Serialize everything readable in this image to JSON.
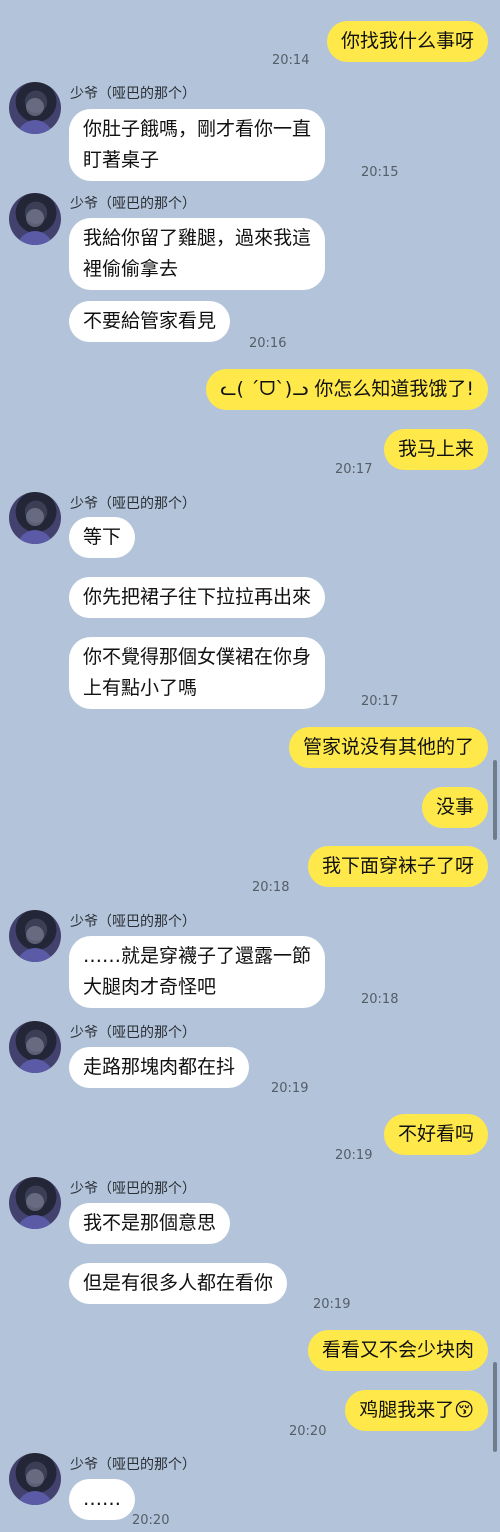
{
  "contact": {
    "name": "少爷（哑巴的那个）"
  },
  "colors": {
    "background": "#b3c4da",
    "outgoing": "#ffe94a",
    "incoming": "#ffffff"
  },
  "messages": [
    {
      "text": "你找我什么事呀",
      "time": "20:14"
    },
    {
      "text": "你肚子餓嗎，剛才看你一直\n盯著桌子",
      "time": "20:15"
    },
    {
      "text": "我給你留了雞腿，過來我這\n裡偷偷拿去"
    },
    {
      "text": "不要給管家看見",
      "time": "20:16"
    },
    {
      "text": "ᓚ( ´ᗜ`)ᓗ 你怎么知道我饿了!"
    },
    {
      "text": "我马上来",
      "time": "20:17"
    },
    {
      "text": "等下"
    },
    {
      "text": "你先把裙子往下拉拉再出來"
    },
    {
      "text": "你不覺得那個女僕裙在你身\n上有點小了嗎",
      "time": "20:17"
    },
    {
      "text": "管家说没有其他的了"
    },
    {
      "text": "没事"
    },
    {
      "text": "我下面穿袜子了呀",
      "time": "20:18"
    },
    {
      "text": "……就是穿襪子了還露一節\n大腿肉才奇怪吧",
      "time": "20:18"
    },
    {
      "text": "走路那塊肉都在抖",
      "time": "20:19"
    },
    {
      "text": "不好看吗",
      "time": "20:19"
    },
    {
      "text": "我不是那個意思"
    },
    {
      "text": "但是有很多人都在看你",
      "time": "20:19"
    },
    {
      "text": "看看又不会少块肉"
    },
    {
      "text": "鸡腿我来了😚",
      "time": "20:20"
    },
    {
      "text": "……",
      "time": "20:20"
    }
  ]
}
